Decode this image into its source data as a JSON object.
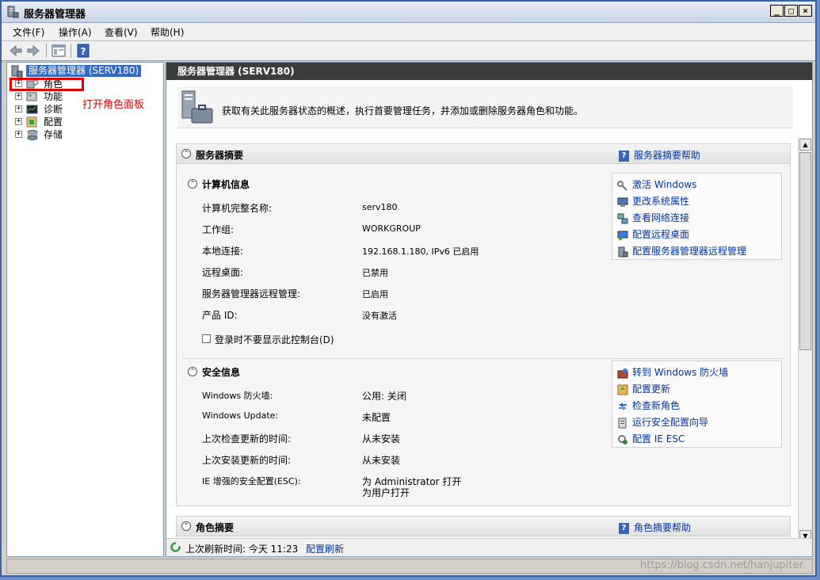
{
  "window": {
    "title": "服务器管理器",
    "controls": [
      "_",
      "□",
      "×"
    ]
  },
  "menu": [
    "文件(F)",
    "操作(A)",
    "查看(V)",
    "帮助(H)"
  ],
  "tree": {
    "root": "服务器管理器 (SERV180)",
    "items": [
      {
        "label": "角色",
        "icon": "roles-icon"
      },
      {
        "label": "功能",
        "icon": "features-icon"
      },
      {
        "label": "诊断",
        "icon": "diagnostics-icon"
      },
      {
        "label": "配置",
        "icon": "configuration-icon"
      },
      {
        "label": "存储",
        "icon": "storage-icon"
      }
    ]
  },
  "annotation": "打开角色面板",
  "content": {
    "header": "服务器管理器 (SERV180)",
    "intro": "获取有关此服务器状态的概述，执行首要管理任务，并添加或删除服务器角色和功能。",
    "summary": {
      "title": "服务器摘要",
      "help": "服务器摘要帮助",
      "computer_info": {
        "title": "计算机信息",
        "rows": [
          {
            "k": "计算机完整名称:",
            "v": "serv180"
          },
          {
            "k": "工作组:",
            "v": "WORKGROUP"
          },
          {
            "k": "本地连接:",
            "v": "192.168.1.180, IPv6 已启用"
          },
          {
            "k": "远程桌面:",
            "v": "已禁用"
          },
          {
            "k": "服务器管理器远程管理:",
            "v": "已启用"
          },
          {
            "k": "产品 ID:",
            "v": "没有激活"
          }
        ],
        "checkbox": "登录时不要显示此控制台(D)",
        "tasks": [
          "激活 Windows",
          "更改系统属性",
          "查看网络连接",
          "配置远程桌面",
          "配置服务器管理器远程管理"
        ]
      },
      "security_info": {
        "title": "安全信息",
        "rows": [
          {
            "k": "Windows 防火墙:",
            "v": "公用: 关闭"
          },
          {
            "k": "Windows Update:",
            "v": "未配置"
          },
          {
            "k": "上次检查更新的时间:",
            "v": "从未安装"
          },
          {
            "k": "上次安装更新的时间:",
            "v": "从未安装"
          },
          {
            "k": "IE 增强的安全配置(ESC):",
            "v": "为 Administrator 打开"
          }
        ],
        "esc_extra": "为用户打开",
        "tasks": [
          "转到 Windows 防火墙",
          "配置更新",
          "检查新角色",
          "运行安全配置向导",
          "配置 IE ESC"
        ]
      }
    },
    "roles_summary": {
      "title": "角色摘要",
      "help": "角色摘要帮助"
    },
    "footer": {
      "refresh_text": "上次刷新时间: 今天 11:23",
      "refresh_link": "配置刷新"
    }
  },
  "watermark": "https://blog.csdn.net/hanjupiter",
  "colors": {
    "accent": "#316ac5",
    "link": "#0033aa",
    "annotation": "#e00000",
    "header_bg": "#3c3c3c"
  }
}
